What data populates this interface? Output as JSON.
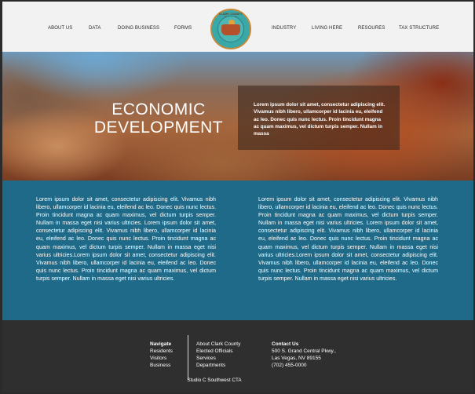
{
  "header": {
    "nav_left": [
      "ABOUT US",
      "DATA",
      "DOING BUSINESS",
      "FORMS"
    ],
    "nav_right": [
      "INDUSTRY",
      "LIVING HERE",
      "RESOURES",
      "TAX STRUCTURE"
    ],
    "logo_text": "CLARK COUNTY NEVADA"
  },
  "hero": {
    "title_line1": "ECONOMIC",
    "title_line2": "DEVELOPMENT",
    "box_text": "Lorem ipsum dolor sit amet, consectetur adipiscing elit. Vivamus nibh libero, ullamcorper id lacinia eu, eleifend ac leo. Donec quis nunc lectus. Proin tincidunt magna ac quam maximus, vel dictum turpis semper. Nullam in massa"
  },
  "content": {
    "left_text": "Lorem ipsum dolor sit amet, consectetur adipiscing elit. Vivamus nibh libero, ullamcorper id lacinia eu, eleifend ac leo. Donec quis nunc lectus. Proin tincidunt magna ac quam maximus, vel dictum turpis semper. Nullam in massa eget nisi varius ultricies. Lorem ipsum dolor sit amet, consectetur adipiscing elit. Vivamus nibh libero, ullamcorper id lacinia eu, eleifend ac leo. Donec quis nunc lectus. Proin tincidunt magna ac quam maximus, vel dictum turpis semper. Nullam in massa eget nisi varius ultricies.Lorem ipsum dolor sit amet, consectetur adipiscing elit. Vivamus nibh libero, ullamcorper id lacinia eu, eleifend ac leo. Donec quis nunc lectus. Proin tincidunt magna ac quam maximus, vel dictum turpis semper. Nullam in massa eget nisi varius ultricies.",
    "right_text": "Lorem ipsum dolor sit amet, consectetur adipiscing elit. Vivamus nibh libero, ullamcorper id lacinia eu, eleifend ac leo. Donec quis nunc lectus. Proin tincidunt magna ac quam maximus, vel dictum turpis semper. Nullam in massa eget nisi varius ultricies. Lorem ipsum dolor sit amet, consectetur adipiscing elit. Vivamus nibh libero, ullamcorper id lacinia eu, eleifend ac leo. Donec quis nunc lectus. Proin tincidunt magna ac quam maximus, vel dictum turpis semper. Nullam in massa eget nisi varius ultricies.Lorem ipsum dolor sit amet, consectetur adipiscing elit. Vivamus nibh libero, ullamcorper id lacinia eu, eleifend ac leo. Donec quis nunc lectus. Proin tincidunt magna ac quam maximus, vel dictum turpis semper. Nullam in massa eget nisi varius ultricies."
  },
  "footer": {
    "navigate_head": "Navigate",
    "navigate_links": [
      "Residents",
      "Visitors",
      "Business"
    ],
    "info_links": [
      "About Clark County",
      "Elected Officials",
      "Services",
      "Departments"
    ],
    "contact_head": "Contact Us",
    "contact_lines": [
      "500 S. Grand Central Pkwy.,",
      "Las Vegas, NV 89155",
      "(702) 455-0000"
    ],
    "credit": "Studio C Southwest CTA"
  },
  "colors": {
    "content_bg": "#1e6a88",
    "footer_bg": "#2f2f2f",
    "header_bg": "#f2f2f2"
  }
}
